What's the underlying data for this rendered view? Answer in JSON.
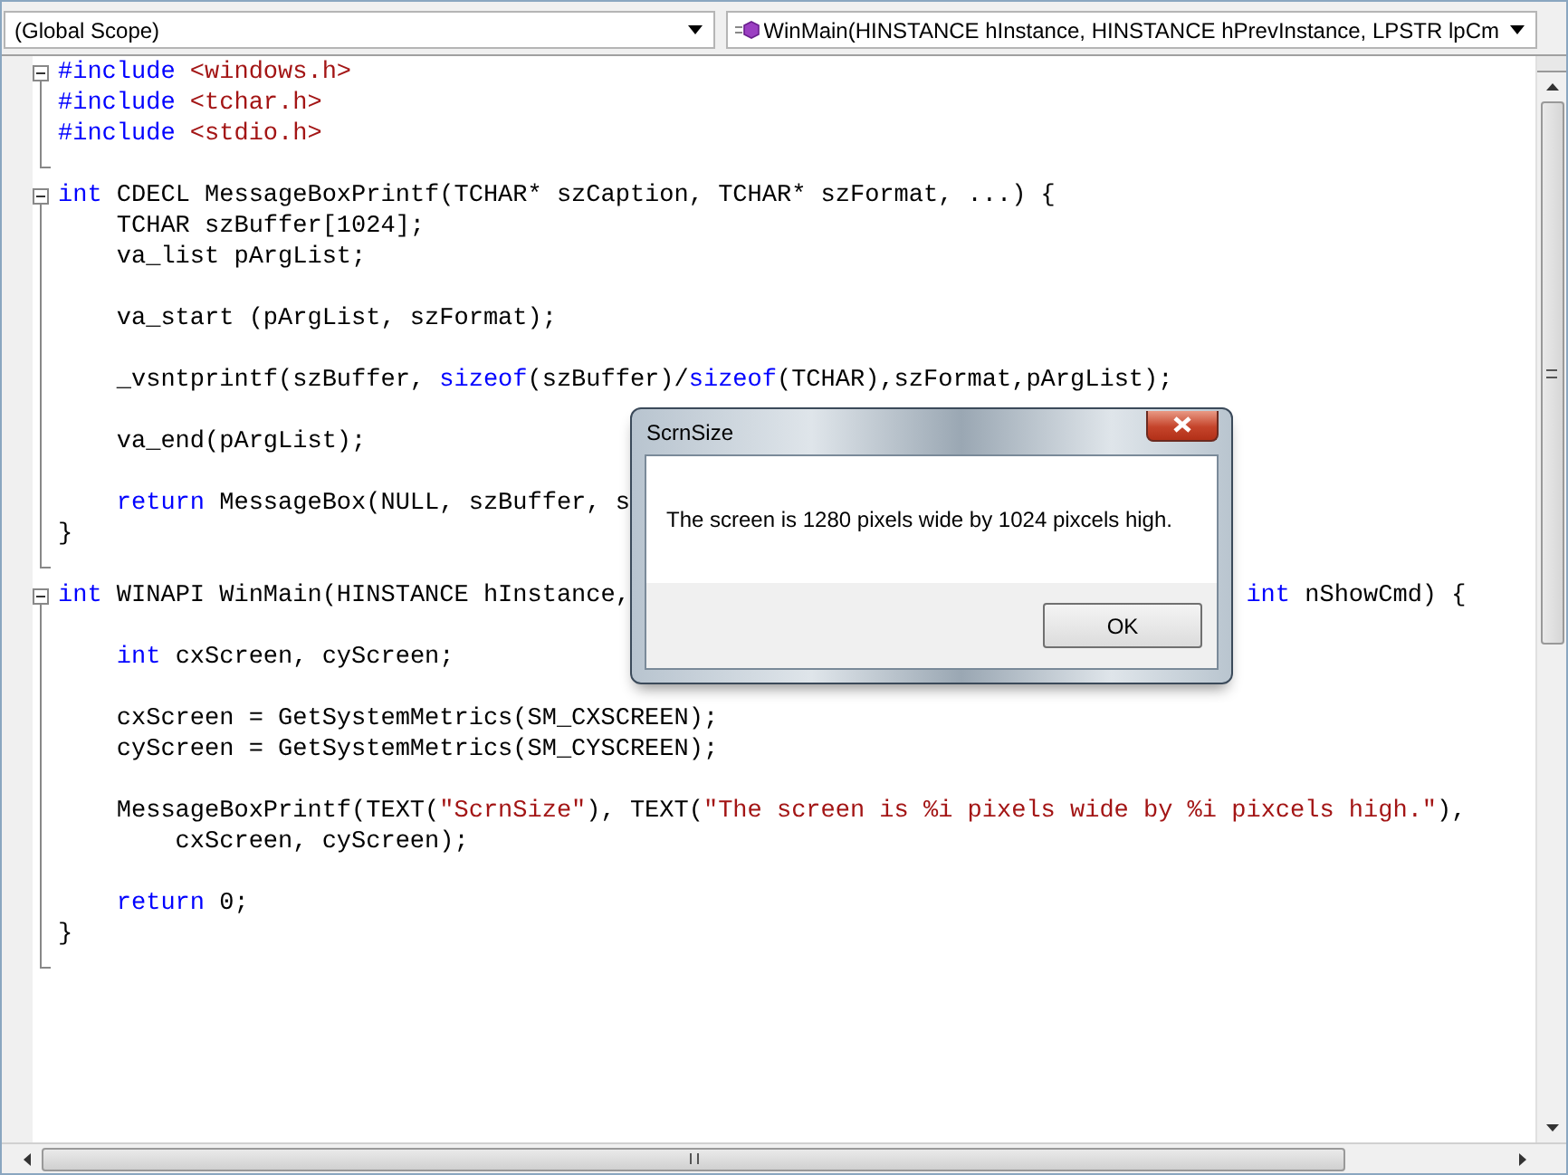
{
  "scope_dropdown": {
    "value": "(Global Scope)"
  },
  "member_dropdown": {
    "value": "WinMain(HINSTANCE hInstance, HINSTANCE hPrevInstance, LPSTR lpCm"
  },
  "regions": [
    {
      "expanded": true,
      "lines": [
        {
          "kind": "code",
          "segments": [
            [
              {
                "kind": "keyword",
                "text": "#include"
              },
              {
                "kind": "string",
                "text": " <windows.h>"
              }
            ]
          ]
        },
        {
          "kind": "code",
          "segments": [
            [
              {
                "kind": "keyword",
                "text": "#include"
              },
              {
                "kind": "string",
                "text": " <tchar.h>"
              }
            ]
          ]
        },
        {
          "kind": "code",
          "segments": [
            [
              {
                "kind": "keyword",
                "text": "#include"
              },
              {
                "kind": "string",
                "text": " <stdio.h>"
              }
            ]
          ]
        },
        {
          "kind": "blank"
        }
      ]
    },
    {
      "expanded": true,
      "lines": [
        {
          "kind": "code",
          "segments": [
            [
              {
                "kind": "keyword",
                "text": "int"
              },
              {
                "kind": "plain",
                "text": " CDECL MessageBoxPrintf(TCHAR* szCaption, TCHAR* szFormat, ...) {"
              }
            ]
          ]
        },
        {
          "kind": "code",
          "segments": [
            [
              {
                "kind": "plain",
                "text": "    TCHAR szBuffer[1024];"
              }
            ]
          ]
        },
        {
          "kind": "code",
          "segments": [
            [
              {
                "kind": "plain",
                "text": "    va_list pArgList;"
              }
            ]
          ]
        },
        {
          "kind": "blank"
        },
        {
          "kind": "code",
          "segments": [
            [
              {
                "kind": "plain",
                "text": "    va_start (pArgList, szFormat);"
              }
            ]
          ]
        },
        {
          "kind": "blank"
        },
        {
          "kind": "code",
          "segments": [
            [
              {
                "kind": "plain",
                "text": "    _vsntprintf(szBuffer, "
              },
              {
                "kind": "keyword",
                "text": "sizeof"
              },
              {
                "kind": "plain",
                "text": "(szBuffer)/"
              },
              {
                "kind": "keyword",
                "text": "sizeof"
              },
              {
                "kind": "plain",
                "text": "(TCHAR),szFormat,pArgList);"
              }
            ]
          ]
        },
        {
          "kind": "blank"
        },
        {
          "kind": "code",
          "segments": [
            [
              {
                "kind": "plain",
                "text": "    va_end(pArgList);"
              }
            ]
          ]
        },
        {
          "kind": "blank"
        },
        {
          "kind": "code",
          "segments": [
            [
              {
                "kind": "keyword",
                "text": "    return"
              },
              {
                "kind": "plain",
                "text": " MessageBox(NULL, szBuffer, s"
              }
            ]
          ]
        },
        {
          "kind": "code",
          "segments": [
            [
              {
                "kind": "plain",
                "text": "}"
              }
            ]
          ]
        },
        {
          "kind": "blank"
        }
      ]
    },
    {
      "expanded": true,
      "lines": [
        {
          "kind": "code",
          "segments": [
            [
              {
                "kind": "keyword",
                "text": "int"
              },
              {
                "kind": "plain",
                "text": " WINAPI WinMain(HINSTANCE hInstance,"
              }
            ],
            [
              {
                "kind": "keyword",
                "text": "int"
              },
              {
                "kind": "plain",
                "text": " nShowCmd) {"
              }
            ]
          ]
        },
        {
          "kind": "blank"
        },
        {
          "kind": "code",
          "segments": [
            [
              {
                "kind": "keyword",
                "text": "    int"
              },
              {
                "kind": "plain",
                "text": " cxScreen, cyScreen;"
              }
            ]
          ]
        },
        {
          "kind": "blank"
        },
        {
          "kind": "code",
          "segments": [
            [
              {
                "kind": "plain",
                "text": "    cxScreen = GetSystemMetrics(SM_CXSCREEN);"
              }
            ]
          ]
        },
        {
          "kind": "code",
          "segments": [
            [
              {
                "kind": "plain",
                "text": "    cyScreen = GetSystemMetrics(SM_CYSCREEN);"
              }
            ]
          ]
        },
        {
          "kind": "blank"
        },
        {
          "kind": "code",
          "segments": [
            [
              {
                "kind": "plain",
                "text": "    MessageBoxPrintf(TEXT("
              },
              {
                "kind": "string",
                "text": "\"ScrnSize\""
              },
              {
                "kind": "plain",
                "text": "), TEXT("
              },
              {
                "kind": "string",
                "text": "\"The screen is %i pixels wide by %i pixcels high.\""
              },
              {
                "kind": "plain",
                "text": "),"
              }
            ]
          ]
        },
        {
          "kind": "code",
          "segments": [
            [
              {
                "kind": "plain",
                "text": "        cxScreen, cyScreen);"
              }
            ]
          ]
        },
        {
          "kind": "blank"
        },
        {
          "kind": "code",
          "segments": [
            [
              {
                "kind": "keyword",
                "text": "    return"
              },
              {
                "kind": "plain",
                "text": " 0;"
              }
            ]
          ]
        },
        {
          "kind": "code",
          "segments": [
            [
              {
                "kind": "plain",
                "text": "}"
              }
            ]
          ]
        },
        {
          "kind": "blank"
        }
      ]
    }
  ],
  "dialog": {
    "title": "ScrnSize",
    "message": "The screen is 1280 pixels wide by 1024 pixcels high.",
    "buttons": [
      "OK"
    ]
  }
}
